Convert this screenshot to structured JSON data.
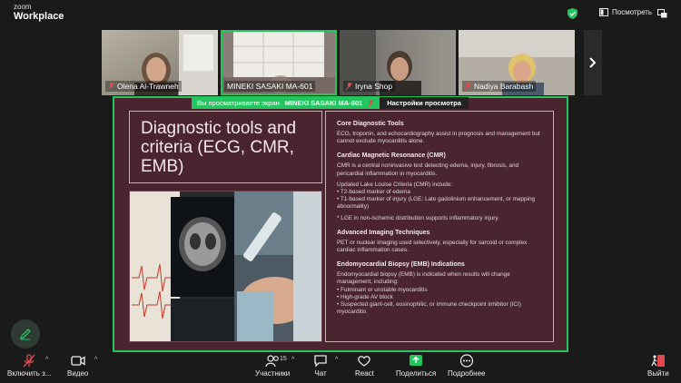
{
  "app": {
    "brand_small": "zoom",
    "brand_big": "Workplace"
  },
  "topbar": {
    "view_label": "Посмотреть"
  },
  "participants": [
    {
      "name": "Olena Al-Trawneh",
      "muted": true
    },
    {
      "name": "MINEKI SASAKI    MA-601",
      "muted": false
    },
    {
      "name": "Iryna Shop",
      "muted": true
    },
    {
      "name": "Nadiya Barabash",
      "muted": true
    }
  ],
  "share": {
    "viewing_label": "Вы просматриваете экран",
    "presenter": "MINEKI SASAKI    MA-601",
    "view_settings": "Настройки просмотра"
  },
  "slide": {
    "title": "Diagnostic tools and criteria (ECG, CMR, EMB)",
    "sections": [
      {
        "title": "Core Diagnostic Tools",
        "text": "ECG, troponin, and echocardiography assist in prognosis and management but cannot exclude myocarditis alone."
      },
      {
        "title": "Cardiac Magnetic Resonance (CMR)",
        "text": "CMR is a central noninvasive test detecting edema, injury, fibrosis, and pericardial inflammation in myocarditis."
      },
      {
        "title": "",
        "text": "Updated Lake Louise Criteria (CMR) include:\n• T2-based marker of edema\n• T1-based marker of injury (LGE: Late gadolinium enhancement, or mapping abnormality)"
      },
      {
        "title": "",
        "text": "* LGE in non-ischemic distribution supports inflammatory injury."
      },
      {
        "title": "Advanced Imaging Techniques",
        "text": "PET or nuclear imaging used selectively, especially for sarcoid or complex cardiac inflammation cases."
      },
      {
        "title": "Endomyocardial Biopsy (EMB) Indications",
        "text": "Endomyocardial biopsy (EMB) is indicated when results will change management, including:\n• Fulminant or unstable myocarditis\n• High-grade AV block\n• Suspected giant-cell, eosinophilic, or immune checkpoint inhibitor (ICI) myocarditis"
      }
    ]
  },
  "toolbar": {
    "mic_label": "Включить з...",
    "video_label": "Видео",
    "participants_label": "Участники",
    "participants_count": "15",
    "chat_label": "Чат",
    "react_label": "React",
    "share_label": "Поделиться",
    "more_label": "Подробнее",
    "leave_label": "Выйти"
  },
  "colors": {
    "accent": "#22c55e",
    "slide_bg": "#4a2530",
    "leave": "#e5484d",
    "mute": "#e5484d"
  },
  "icons": [
    "shield-icon",
    "view-icon",
    "fullscreen-icon",
    "mic-off-icon",
    "video-icon",
    "participants-icon",
    "chat-icon",
    "react-icon",
    "share-icon",
    "more-icon",
    "leave-icon",
    "pencil-icon",
    "chevron-right-icon"
  ]
}
